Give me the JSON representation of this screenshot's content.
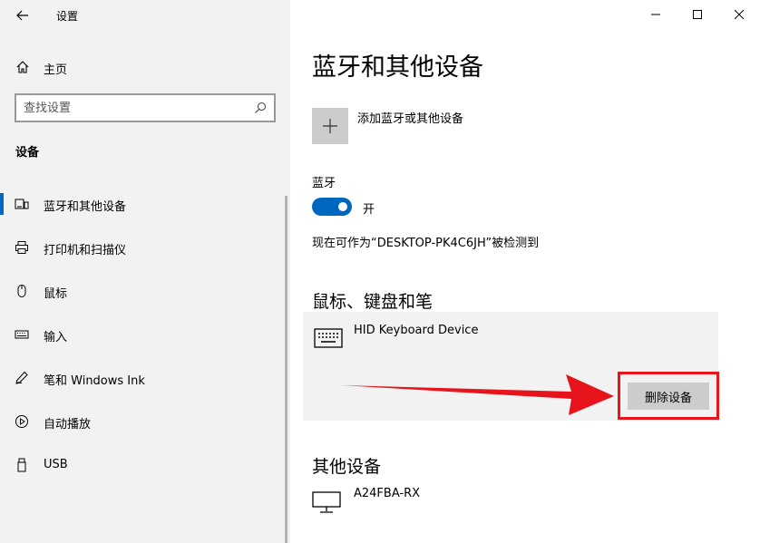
{
  "window": {
    "title": "设置"
  },
  "sidebar": {
    "home_label": "主页",
    "search_placeholder": "查找设置",
    "section_title": "设备",
    "items": [
      {
        "label": "蓝牙和其他设备",
        "icon": "bluetooth-devices-icon",
        "active": true
      },
      {
        "label": "打印机和扫描仪",
        "icon": "printer-icon"
      },
      {
        "label": "鼠标",
        "icon": "mouse-icon"
      },
      {
        "label": "输入",
        "icon": "keyboard-icon"
      },
      {
        "label": "笔和 Windows Ink",
        "icon": "pen-icon"
      },
      {
        "label": "自动播放",
        "icon": "autoplay-icon"
      },
      {
        "label": "USB",
        "icon": "usb-icon"
      }
    ]
  },
  "main": {
    "title": "蓝牙和其他设备",
    "add_device_label": "添加蓝牙或其他设备",
    "bluetooth": {
      "label": "蓝牙",
      "state": "开",
      "on": true,
      "discoverable_text": "现在可作为“DESKTOP-PK4C6JH”被检测到"
    },
    "input_devices": {
      "heading": "鼠标、键盘和笔",
      "device_name": "HID Keyboard Device",
      "remove_label": "删除设备"
    },
    "other_devices": {
      "heading": "其他设备",
      "device_name": "A24FBA-RX"
    }
  },
  "colors": {
    "accent": "#0067c0",
    "annotation": "#e8141c",
    "sidebar_bg": "#f2f2f2"
  }
}
